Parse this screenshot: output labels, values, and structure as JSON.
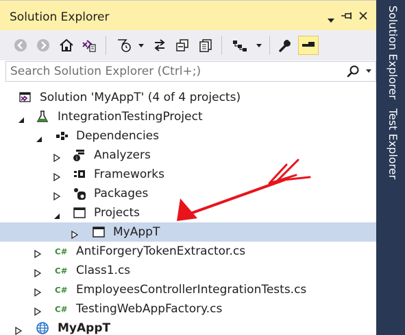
{
  "window": {
    "title": "Solution Explorer",
    "icons": [
      "dropdown-icon",
      "pin-icon",
      "close-icon"
    ]
  },
  "toolbar": {
    "buttons": [
      "back-icon",
      "forward-icon",
      "home-icon",
      "vs-switch-views-icon",
      "pending-changes-filter-icon",
      "sync-icon",
      "collapse-all-icon",
      "show-all-files-icon",
      "view-hierarchy-icon",
      "properties-wrench-icon",
      "preview-selected-icon"
    ]
  },
  "search": {
    "placeholder": "Search Solution Explorer (Ctrl+;)"
  },
  "tree": [
    {
      "label": "Solution 'MyAppT' (4 of 4 projects)",
      "icon": "solution-icon",
      "expander": "none",
      "level": 0
    },
    {
      "label": "IntegrationTestingProject",
      "icon": "test-project-icon",
      "expander": "expanded",
      "level": 1
    },
    {
      "label": "Dependencies",
      "icon": "dependencies-icon",
      "expander": "expanded",
      "level": 2
    },
    {
      "label": "Analyzers",
      "icon": "analyzers-icon",
      "expander": "collapsed",
      "level": 3
    },
    {
      "label": "Frameworks",
      "icon": "frameworks-icon",
      "expander": "collapsed",
      "level": 3
    },
    {
      "label": "Packages",
      "icon": "packages-icon",
      "expander": "collapsed",
      "level": 3
    },
    {
      "label": "Projects",
      "icon": "projects-icon",
      "expander": "expanded",
      "level": 3
    },
    {
      "label": "MyAppT",
      "icon": "project-reference-icon",
      "expander": "collapsed",
      "level": 4,
      "selected": true
    },
    {
      "label": "AntiForgeryTokenExtractor.cs",
      "icon": "csharp-file-icon",
      "expander": "collapsed",
      "level": 2
    },
    {
      "label": "Class1.cs",
      "icon": "csharp-file-icon",
      "expander": "collapsed",
      "level": 2
    },
    {
      "label": "EmployeesControllerIntegrationTests.cs",
      "icon": "csharp-file-icon",
      "expander": "collapsed",
      "level": 2
    },
    {
      "label": "TestingWebAppFactory.cs",
      "icon": "csharp-file-icon",
      "expander": "collapsed",
      "level": 2
    },
    {
      "label": "MyAppT",
      "icon": "web-project-icon",
      "expander": "collapsed",
      "level": 1,
      "bold": true
    }
  ],
  "side_tabs": {
    "solution_explorer": "Solution Explorer",
    "test_explorer": "Test Explorer"
  },
  "colors": {
    "title_bar": "#fef0a8",
    "toolbar": "#eeeef2",
    "selection": "#c9d7ec",
    "side_strip": "#293955",
    "annotation_arrow": "#e8141c",
    "csharp_green": "#388a34"
  }
}
